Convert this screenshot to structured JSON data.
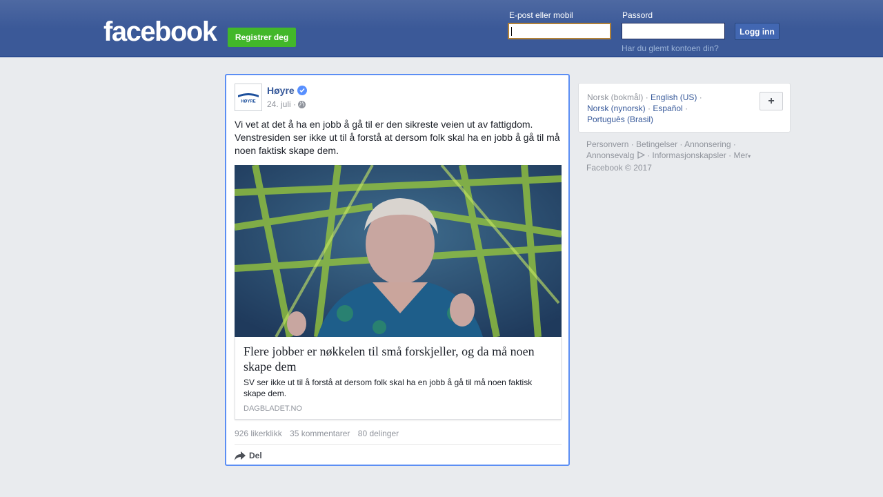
{
  "header": {
    "logo": "facebook",
    "register_label": "Registrer deg",
    "email_label": "E-post eller mobil",
    "password_label": "Passord",
    "login_label": "Logg inn",
    "forgot_label": "Har du glemt kontoen din?"
  },
  "post": {
    "page_name": "Høyre",
    "date": "24. juli ·",
    "text": "Vi vet at det å ha en jobb å gå til er den sikreste veien ut av fattigdom. Venstresiden ser ikke ut til å forstå at dersom folk skal ha en jobb å gå til må noen faktisk skape dem.",
    "link": {
      "title": "Flere jobber er nøkkelen til små forskjeller, og da må noen skape dem",
      "description": "SV ser ikke ut til å forstå at dersom folk skal ha en jobb å gå til må noen faktisk skape dem.",
      "domain": "DAGBLADET.NO"
    },
    "likes": "926 likerklikk",
    "comments": "35 kommentarer",
    "shares": "80 delinger",
    "share_label": "Del"
  },
  "languages": {
    "current": "Norsk (bokmål)",
    "items": [
      "English (US)",
      "Norsk (nynorsk)",
      "Español",
      "Português (Brasil)"
    ],
    "add_label": "+"
  },
  "footer": {
    "privacy": "Personvern",
    "terms": "Betingelser",
    "advertising": "Annonsering",
    "ad_choices": "Annonsevalg",
    "cookies": "Informasjonskapsler",
    "more": "Mer",
    "copyright": "Facebook © 2017"
  },
  "colors": {
    "brand_blue": "#3b5998",
    "register_green": "#42b72a",
    "link_blue": "#365899",
    "focus_border": "#5b8ef4"
  }
}
